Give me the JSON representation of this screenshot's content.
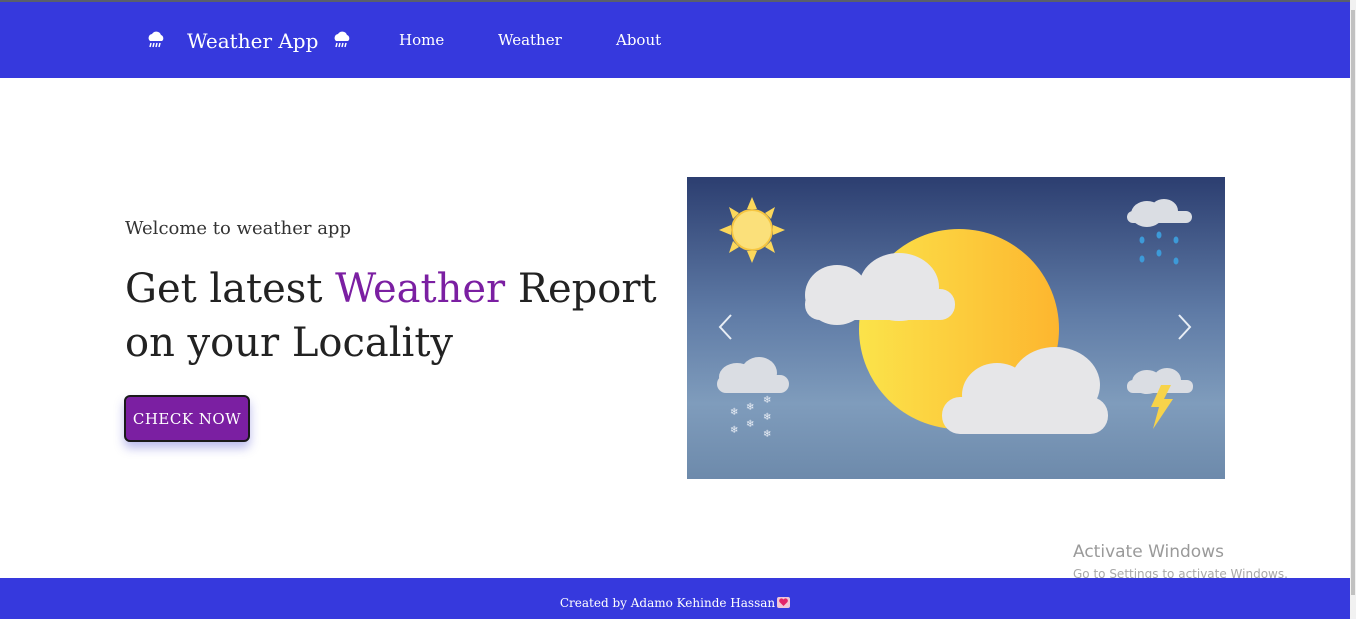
{
  "navbar": {
    "brand": "Weather App",
    "brand_icon": "cloud-rain-icon",
    "nav_icon": "cloud-rain-icon",
    "links": [
      "Home",
      "Weather",
      "About"
    ],
    "bg_color": "#3639dd"
  },
  "hero": {
    "welcome": "Welcome to weather app",
    "headline_part1": "Get latest ",
    "headline_accent": "Weather",
    "headline_part2": " Report on your Locality",
    "button_label": "CHECK NOW",
    "accent_color": "#7b1fa2"
  },
  "carousel": {
    "prev_icon": "chevron-left-icon",
    "next_icon": "chevron-right-icon",
    "image": "weather-illustration"
  },
  "watermark": {
    "title": "Activate Windows",
    "subtitle": "Go to Settings to activate Windows."
  },
  "footer": {
    "text": "Created by Adamo Kehinde Hassan",
    "icon": "heart-icon"
  }
}
